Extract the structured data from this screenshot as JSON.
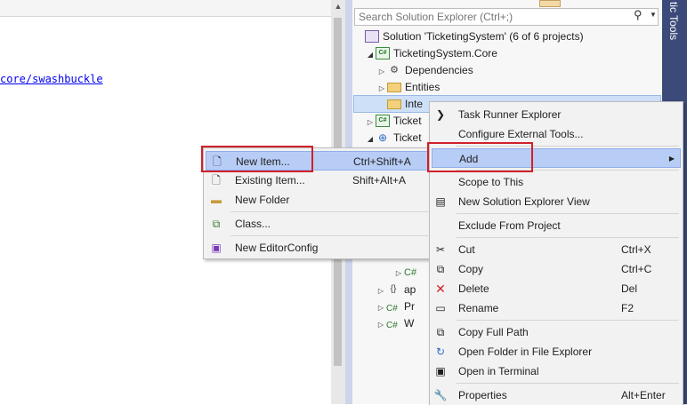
{
  "editor": {
    "link_text": "core/swashbuckle",
    "scroll_up_glyph": "▲"
  },
  "solution_explorer": {
    "search_placeholder": "Search Solution Explorer (Ctrl+;)",
    "search_icon": "magnifier-icon",
    "tree": [
      {
        "label": "Solution 'TicketingSystem' (6 of 6 projects)",
        "icon": "solution-icon"
      },
      {
        "label": "TicketingSystem.Core",
        "icon": "csharp-project-icon"
      },
      {
        "label": "Dependencies",
        "icon": "dependencies-icon"
      },
      {
        "label": "Entities",
        "icon": "folder-icon"
      },
      {
        "label": "Inte",
        "icon": "folder-icon"
      },
      {
        "label": "Ticket",
        "icon": "csharp-project-icon"
      },
      {
        "label": "Ticket",
        "icon": "web-project-icon"
      }
    ],
    "lower_items": [
      {
        "label": "C#",
        "icon": "csharp-file-icon"
      },
      {
        "label": "ap",
        "icon": "json-file-icon"
      },
      {
        "label": "Pr",
        "icon": "csharp-file-icon"
      },
      {
        "label": "W",
        "icon": "csharp-file-icon"
      }
    ],
    "cs_badge": "C#"
  },
  "side_panel": {
    "label": "tic Tools"
  },
  "add_submenu": {
    "items": [
      {
        "label": "New Item...",
        "shortcut": "Ctrl+Shift+A",
        "icon": "new-item-icon"
      },
      {
        "label": "Existing Item...",
        "shortcut": "Shift+Alt+A",
        "icon": "existing-item-icon"
      },
      {
        "label": "New Folder",
        "shortcut": "",
        "icon": "new-folder-icon"
      },
      {
        "label": "Class...",
        "shortcut": "",
        "icon": "class-icon"
      },
      {
        "label": "New EditorConfig",
        "shortcut": "",
        "icon": "editorconfig-icon"
      }
    ]
  },
  "context_menu": {
    "items": [
      {
        "label": "Task Runner Explorer",
        "shortcut": ""
      },
      {
        "label": "Configure External Tools...",
        "shortcut": ""
      },
      {
        "label": "Add",
        "shortcut": ""
      },
      {
        "label": "Scope to This",
        "shortcut": ""
      },
      {
        "label": "New Solution Explorer View",
        "shortcut": ""
      },
      {
        "label": "Exclude From Project",
        "shortcut": ""
      },
      {
        "label": "Cut",
        "shortcut": "Ctrl+X"
      },
      {
        "label": "Copy",
        "shortcut": "Ctrl+C"
      },
      {
        "label": "Delete",
        "shortcut": "Del"
      },
      {
        "label": "Rename",
        "shortcut": "F2"
      },
      {
        "label": "Copy Full Path",
        "shortcut": ""
      },
      {
        "label": "Open Folder in File Explorer",
        "shortcut": ""
      },
      {
        "label": "Open in Terminal",
        "shortcut": ""
      },
      {
        "label": "Properties",
        "shortcut": "Alt+Enter"
      }
    ],
    "submenu_arrow": "▶"
  },
  "colors": {
    "highlight": "#b8cdf6",
    "annotation_red": "#d1202a",
    "side_strip": "#3c4a7a"
  }
}
